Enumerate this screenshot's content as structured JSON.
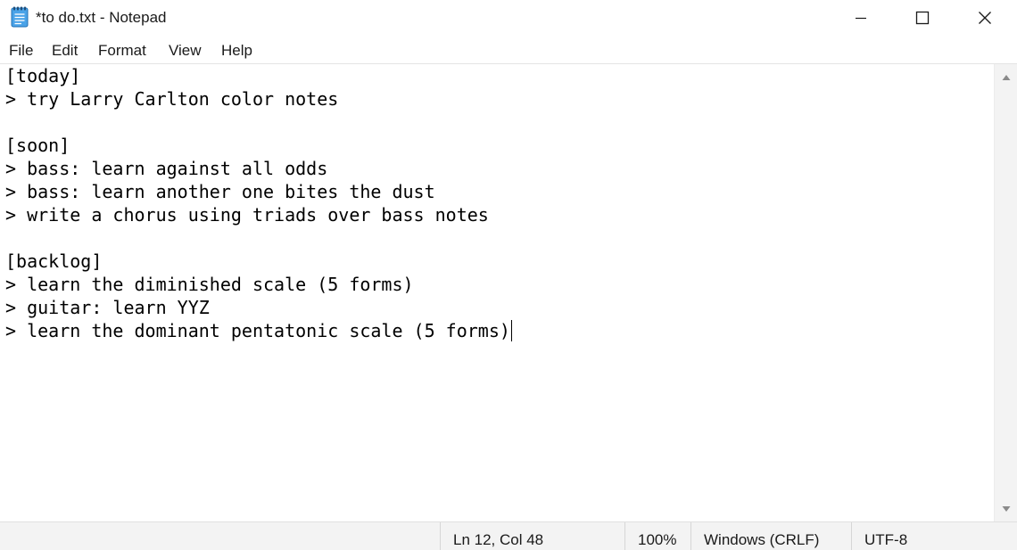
{
  "window": {
    "title": "*to do.txt - Notepad",
    "app_icon": "notepad-icon",
    "controls": {
      "minimize_icon": "minimize-icon",
      "maximize_icon": "maximize-icon",
      "close_icon": "close-icon"
    }
  },
  "menu": {
    "file": "File",
    "edit": "Edit",
    "format": "Format",
    "view": "View",
    "help": "Help"
  },
  "editor": {
    "lines": [
      "[today]",
      "> try Larry Carlton color notes",
      "",
      "[soon]",
      "> bass: learn against all odds",
      "> bass: learn another one bites the dust",
      "> write a chorus using triads over bass notes",
      "",
      "[backlog]",
      "> learn the diminished scale (5 forms)",
      "> guitar: learn YYZ",
      "> learn the dominant pentatonic scale (5 forms)"
    ]
  },
  "scrollbar": {
    "up_icon": "scroll-up-arrow-icon",
    "down_icon": "scroll-down-arrow-icon"
  },
  "status": {
    "position": "Ln 12, Col 48",
    "zoom": "100%",
    "line_ending": "Windows (CRLF)",
    "encoding": "UTF-8"
  },
  "colors": {
    "accent_icon": "#2b88d8",
    "window_background": "#ffffff",
    "statusbar_background": "#f3f3f3"
  }
}
